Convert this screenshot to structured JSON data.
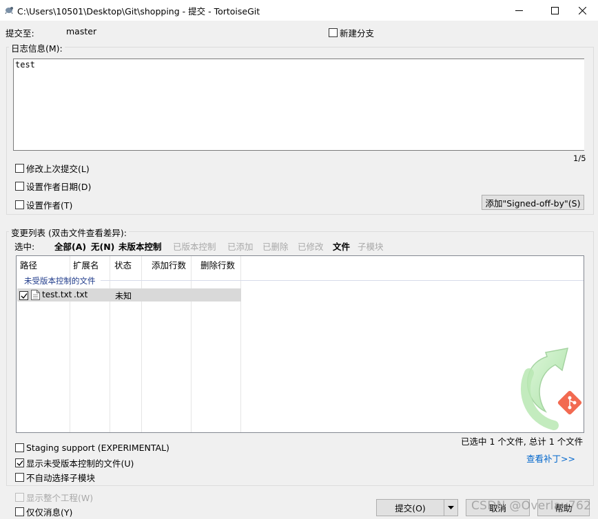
{
  "window": {
    "title": "C:\\Users\\10501\\Desktop\\Git\\shopping - 提交 - TortoiseGit",
    "minimize_glyph": "—",
    "maximize_glyph": "☐",
    "close_glyph": "✕"
  },
  "commit_to": {
    "label": "提交至:",
    "branch": "master"
  },
  "new_branch": {
    "label": "新建分支",
    "checked": false
  },
  "log_message": {
    "group_label": "日志信息(M):",
    "text": "test",
    "counter": "1/5"
  },
  "options": {
    "amend": {
      "label": "修改上次提交(L)",
      "checked": false
    },
    "set_date": {
      "label": "设置作者日期(D)",
      "checked": false
    },
    "set_author": {
      "label": "设置作者(T)",
      "checked": false
    },
    "signoff_button": "添加\"Signed-off-by\"(S)"
  },
  "changes": {
    "group_label": "变更列表 (双击文件查看差异):",
    "select_label": "选中:",
    "filters": [
      {
        "label": "全部(A)",
        "enabled": true
      },
      {
        "label": "无(N)",
        "enabled": true
      },
      {
        "label": "未版本控制",
        "enabled": true
      },
      {
        "label": "已版本控制",
        "enabled": false
      },
      {
        "label": "已添加",
        "enabled": false
      },
      {
        "label": "已删除",
        "enabled": false
      },
      {
        "label": "已修改",
        "enabled": false
      },
      {
        "label": "文件",
        "enabled": true
      },
      {
        "label": "子模块",
        "enabled": false
      }
    ],
    "columns": [
      "路径",
      "扩展名",
      "状态",
      "添加行数",
      "删除行数"
    ],
    "group_name": "未受版本控制的文件",
    "rows": [
      {
        "checked": true,
        "path": "test.txt",
        "ext": ".txt",
        "status": "未知",
        "added": "",
        "deleted": ""
      }
    ],
    "summary": "已选中 1 个文件, 总计 1 个文件",
    "view_patch": "查看补丁>>"
  },
  "bottom_options": {
    "staging": {
      "label": "Staging support (EXPERIMENTAL)",
      "checked": false
    },
    "show_unversioned": {
      "label": "显示未受版本控制的文件(U)",
      "checked": true
    },
    "no_auto_submodule": {
      "label": "不自动选择子模块",
      "checked": false
    },
    "show_whole_project": {
      "label": "显示整个工程(W)",
      "checked": false,
      "enabled": false
    },
    "message_only": {
      "label": "仅仅消息(Y)",
      "checked": false
    }
  },
  "buttons": {
    "commit": "提交(O)",
    "cancel": "取消",
    "help": "帮助"
  },
  "watermark": "CSDN @Overlay762",
  "colors": {
    "link": "#0066cc",
    "group_text": "#1e3a8a",
    "disabled": "#a9a9a9"
  }
}
